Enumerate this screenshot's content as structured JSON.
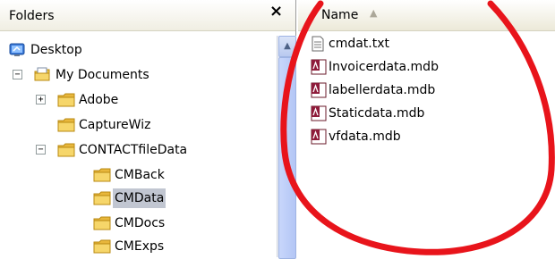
{
  "folders_pane": {
    "title": "Folders",
    "close_symbol": "×"
  },
  "tree": [
    {
      "label": "Desktop",
      "icon": "desktop-icon",
      "expander": ""
    },
    {
      "label": "My Documents",
      "icon": "my-documents-icon",
      "expander": "−"
    },
    {
      "label": "Adobe",
      "icon": "folder-icon",
      "expander": "+"
    },
    {
      "label": "CaptureWiz",
      "icon": "folder-icon",
      "expander": ""
    },
    {
      "label": "CONTACTfileData",
      "icon": "folder-icon",
      "expander": "−"
    },
    {
      "label": "CMBack",
      "icon": "folder-icon",
      "expander": ""
    },
    {
      "label": "CMData",
      "icon": "folder-icon",
      "expander": "",
      "selected": true
    },
    {
      "label": "CMDocs",
      "icon": "folder-icon",
      "expander": ""
    },
    {
      "label": "CMExps",
      "icon": "folder-icon",
      "expander": ""
    }
  ],
  "files_pane": {
    "column_name": "Name",
    "sort_arrow": "▲"
  },
  "files": [
    {
      "name": "cmdat.txt",
      "icon": "text-file-icon"
    },
    {
      "name": "Invoicerdata.mdb",
      "icon": "access-db-icon"
    },
    {
      "name": "labellerdata.mdb",
      "icon": "access-db-icon"
    },
    {
      "name": "Staticdata.mdb",
      "icon": "access-db-icon"
    },
    {
      "name": "vfdata.mdb",
      "icon": "access-db-icon"
    }
  ],
  "colors": {
    "selection": "#c1c6d1",
    "folder": "#f6d66a",
    "annotation": "#e8141b"
  }
}
